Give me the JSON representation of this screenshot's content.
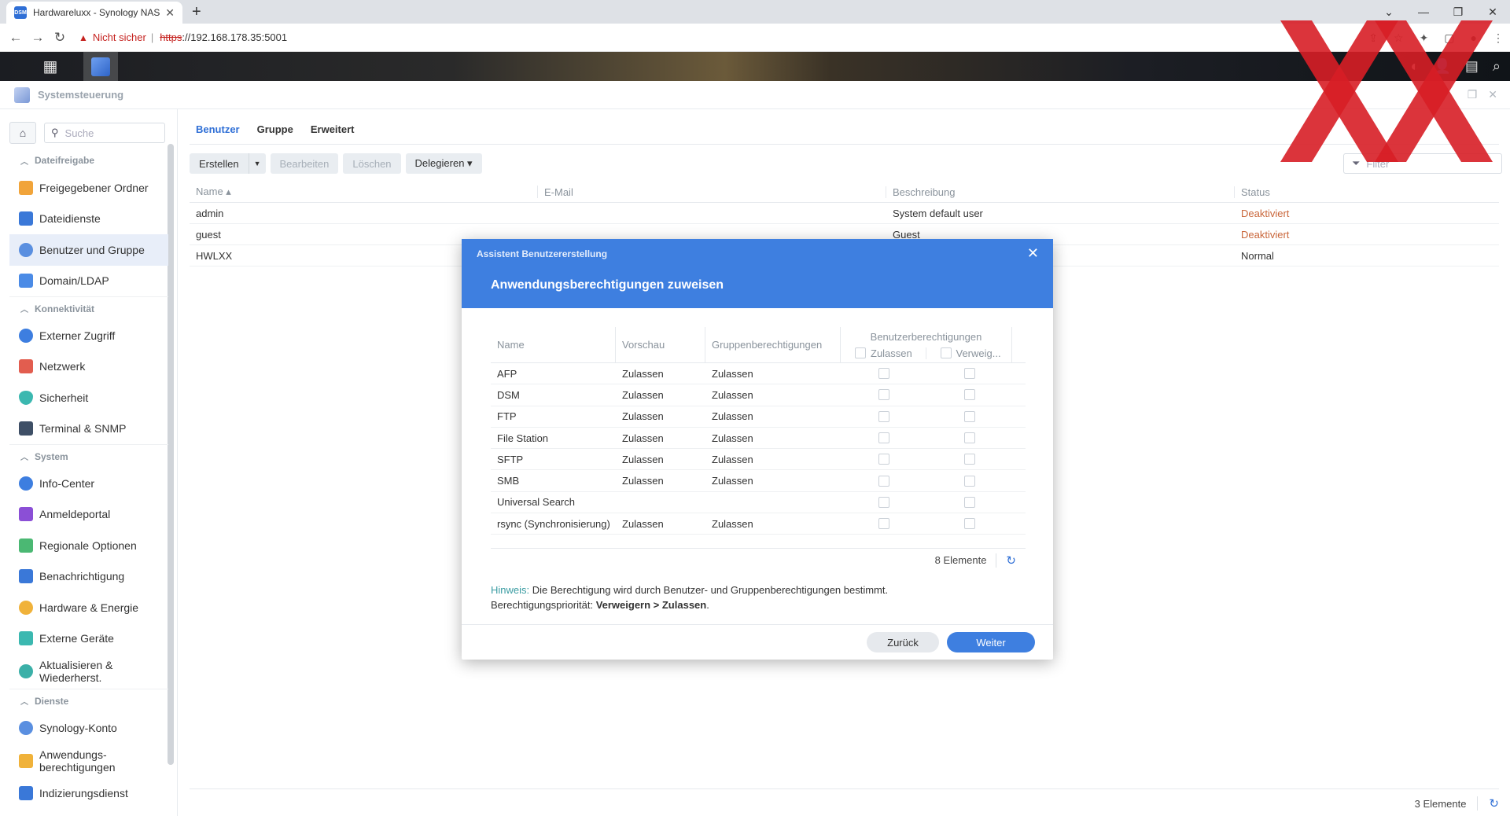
{
  "browser": {
    "tab_title": "Hardwareluxx - Synology NAS",
    "favicon_text": "DSM",
    "new_tab": "+",
    "not_secure": "Nicht sicher",
    "url_scheme": "https",
    "url_rest": "://192.168.178.35:5001"
  },
  "window": {
    "title": "Systemsteuerung"
  },
  "sidebar": {
    "search_placeholder": "Suche",
    "sections": [
      {
        "label": "Dateifreigabe",
        "items": [
          "Freigegebener Ordner",
          "Dateidienste",
          "Benutzer und Gruppe",
          "Domain/LDAP"
        ]
      },
      {
        "label": "Konnektivität",
        "items": [
          "Externer Zugriff",
          "Netzwerk",
          "Sicherheit",
          "Terminal & SNMP"
        ]
      },
      {
        "label": "System",
        "items": [
          "Info-Center",
          "Anmeldeportal",
          "Regionale Optionen",
          "Benachrichtigung",
          "Hardware & Energie",
          "Externe Geräte",
          "Aktualisieren & Wiederherst."
        ]
      },
      {
        "label": "Dienste",
        "items": [
          "Synology-Konto",
          "Anwendungs-berechtigungen",
          "Indizierungsdienst"
        ]
      }
    ]
  },
  "main": {
    "tabs": [
      "Benutzer",
      "Gruppe",
      "Erweitert"
    ],
    "toolbar": {
      "create": "Erstellen",
      "edit": "Bearbeiten",
      "delete": "Löschen",
      "delegate": "Delegieren ▾"
    },
    "filter_placeholder": "Filter",
    "columns": [
      "Name ▴",
      "E-Mail",
      "Beschreibung",
      "Status"
    ],
    "rows": [
      {
        "name": "admin",
        "email": "",
        "desc": "System default user",
        "status": "Deaktiviert"
      },
      {
        "name": "guest",
        "email": "",
        "desc": "Guest",
        "status": "Deaktiviert"
      },
      {
        "name": "HWLXX",
        "email": "",
        "desc": "",
        "status": "Normal"
      }
    ],
    "footer_count": "3 Elemente"
  },
  "dialog": {
    "subtitle": "Assistent Benutzererstellung",
    "title": "Anwendungsberechtigungen zuweisen",
    "columns": {
      "name": "Name",
      "preview": "Vorschau",
      "group": "Gruppenberechtigungen",
      "user": "Benutzerberechtigungen",
      "allow": "Zulassen",
      "deny": "Verweig..."
    },
    "rows": [
      {
        "name": "AFP",
        "preview": "Zulassen",
        "group": "Zulassen"
      },
      {
        "name": "DSM",
        "preview": "Zulassen",
        "group": "Zulassen"
      },
      {
        "name": "FTP",
        "preview": "Zulassen",
        "group": "Zulassen"
      },
      {
        "name": "File Station",
        "preview": "Zulassen",
        "group": "Zulassen"
      },
      {
        "name": "SFTP",
        "preview": "Zulassen",
        "group": "Zulassen"
      },
      {
        "name": "SMB",
        "preview": "Zulassen",
        "group": "Zulassen"
      },
      {
        "name": "Universal Search",
        "preview": "",
        "group": ""
      },
      {
        "name": "rsync (Synchronisierung)",
        "preview": "Zulassen",
        "group": "Zulassen"
      }
    ],
    "count": "8 Elemente",
    "hint_label": "Hinweis:",
    "hint_text": " Die Berechtigung wird durch Benutzer- und Gruppenberechtigungen bestimmt.",
    "priority_label": "Berechtigungspriorität: ",
    "priority_value": "Verweigern > Zulassen",
    "priority_end": ".",
    "back": "Zurück",
    "next": "Weiter"
  },
  "colors": {
    "accent": "#3e7fe0",
    "status_off": "#c9663a",
    "watermark": "#d71e26"
  }
}
